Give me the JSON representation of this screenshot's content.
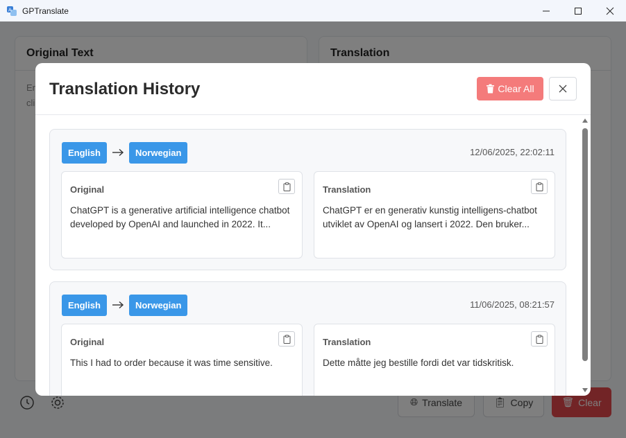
{
  "window": {
    "title": "GPTranslate",
    "controls": [
      "minimize-icon",
      "maximize-icon",
      "close-icon"
    ]
  },
  "app": {
    "original_panel_title": "Original Text",
    "original_placeholder_visible": "En\ncli",
    "translation_panel_title": "Translation",
    "buttons": {
      "translate": "Translate",
      "copy": "Copy",
      "clear": "Clear"
    },
    "footer_icons": [
      "history-icon",
      "settings-icon"
    ]
  },
  "modal": {
    "title": "Translation History",
    "clear_all_label": "Clear All",
    "entries": [
      {
        "source_lang": "English",
        "target_lang": "Norwegian",
        "timestamp": "12/06/2025, 22:02:11",
        "original_label": "Original",
        "original_text": "ChatGPT is a generative artificial intelligence chatbot developed by OpenAI and launched in 2022. It...",
        "translation_label": "Translation",
        "translation_text": "ChatGPT er en generativ kunstig intelligens-chatbot utviklet av OpenAI og lansert i 2022. Den bruker..."
      },
      {
        "source_lang": "English",
        "target_lang": "Norwegian",
        "timestamp": "11/06/2025, 08:21:57",
        "original_label": "Original",
        "original_text": "This I had to order because it was time sensitive.",
        "translation_label": "Translation",
        "translation_text": "Dette måtte jeg bestille fordi det var tidskritisk."
      }
    ]
  },
  "colors": {
    "lang_tag": "#3a97e8",
    "clear_all": "#f47b7b",
    "danger": "#e5484d"
  }
}
